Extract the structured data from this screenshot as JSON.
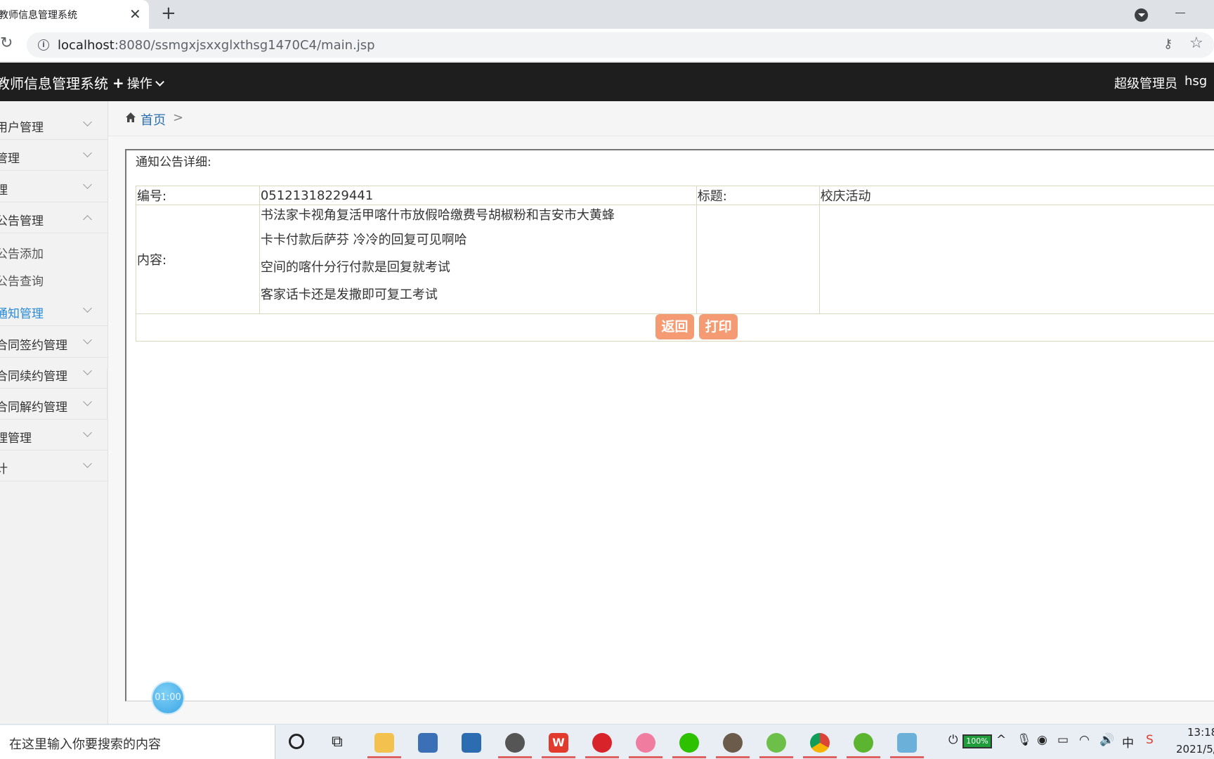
{
  "browser": {
    "tab_title": "教师信息管理系统",
    "tab_close": "✕",
    "new_tab": "+",
    "url_host": "localhost",
    "url_path": ":8080/ssmgxjsxxglxthsg1470C4/main.jsp"
  },
  "header": {
    "app_title": "教师信息管理系统",
    "ops_label": "操作",
    "role": "超级管理员",
    "user": "hsg"
  },
  "sidebar": {
    "items": [
      {
        "label": "用户管理",
        "expanded": false
      },
      {
        "label": "管理",
        "expanded": false
      },
      {
        "label": "理",
        "expanded": false
      },
      {
        "label": "公告管理",
        "expanded": true
      },
      {
        "label": "通知管理",
        "expanded": false,
        "active": true
      },
      {
        "label": "合同签约管理",
        "expanded": false
      },
      {
        "label": "合同续约管理",
        "expanded": false
      },
      {
        "label": "合同解约管理",
        "expanded": false
      },
      {
        "label": "理管理",
        "expanded": false
      },
      {
        "label": "计",
        "expanded": false
      }
    ],
    "sub_items": [
      "公告添加",
      "公告查询"
    ]
  },
  "breadcrumb": {
    "home": "首页",
    "separator": ">"
  },
  "detail": {
    "title": "通知公告详细:",
    "id_label": "编号:",
    "id_value": "05121318229441",
    "title_label": "标题:",
    "title_value": "校庆活动",
    "content_label": "内容:",
    "content_lines": [
      "书法家卡视角复活甲喀什市放假哈缴费号胡椒粉和吉安市大黄蜂",
      "卡卡付款后萨芬 冷冷的回复可见啊哈",
      "空间的喀什分行付款是回复就考试",
      "客家话卡还是发撒即可复工考试"
    ],
    "back_button": "返回",
    "print_button": "打印"
  },
  "timer": "01:00",
  "taskbar": {
    "search_placeholder": "在这里输入你要搜索的内容",
    "battery": "100%",
    "ime": "中",
    "time": "13:18",
    "date": "2021/5/"
  },
  "colors": {
    "appbar": "#1e1e1e",
    "active_menu": "#2a8bd4",
    "button": "#f59b73",
    "table_border": "#d9d9c0"
  }
}
